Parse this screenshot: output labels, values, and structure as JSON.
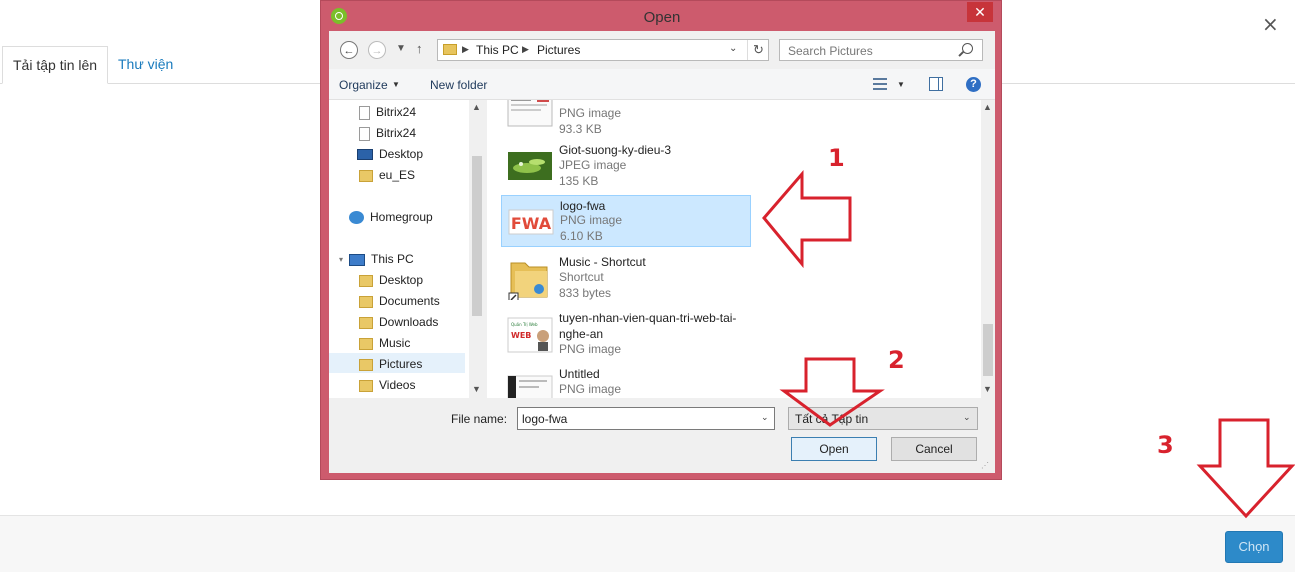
{
  "page": {
    "close_glyph": "×",
    "tabs": [
      "Tải tập tin lên",
      "Thư viện"
    ],
    "choose_button": "Chọn"
  },
  "dialog": {
    "title": "Open",
    "close_glyph": "✕",
    "address": {
      "segments": [
        "This PC",
        "Pictures"
      ]
    },
    "search_placeholder": "Search Pictures",
    "toolbar": {
      "organize": "Organize",
      "new_folder": "New folder",
      "help": "?"
    },
    "nav": [
      {
        "label": "Bitrix24",
        "icon": "document-icon"
      },
      {
        "label": "Bitrix24",
        "icon": "document-icon"
      },
      {
        "label": "Desktop",
        "icon": "desktop-icon"
      },
      {
        "label": "eu_ES",
        "icon": "folder-icon"
      },
      {
        "label": "Homegroup",
        "icon": "homegroup-icon"
      },
      {
        "label": "This PC",
        "icon": "computer-icon"
      },
      {
        "label": "Desktop",
        "icon": "folder-icon"
      },
      {
        "label": "Documents",
        "icon": "folder-icon"
      },
      {
        "label": "Downloads",
        "icon": "folder-icon"
      },
      {
        "label": "Music",
        "icon": "folder-icon"
      },
      {
        "label": "Pictures",
        "icon": "folder-icon",
        "selected": true
      },
      {
        "label": "Videos",
        "icon": "folder-icon"
      }
    ],
    "files": [
      {
        "name": "",
        "type": "PNG image",
        "size": "93.3 KB"
      },
      {
        "name": "Giot-suong-ky-dieu-3",
        "type": "JPEG image",
        "size": "135 KB"
      },
      {
        "name": "logo-fwa",
        "type": "PNG image",
        "size": "6.10 KB",
        "selected": true,
        "thumb_text": "FWA"
      },
      {
        "name": "Music - Shortcut",
        "type": "Shortcut",
        "size": "833 bytes"
      },
      {
        "name": "tuyen-nhan-vien-quan-tri-web-tai-nghe-an",
        "type": "PNG image",
        "size": "",
        "thumb_text": "WEB"
      },
      {
        "name": "Untitled",
        "type": "PNG image",
        "size": ""
      }
    ],
    "file_name_label": "File name:",
    "file_name_value": "logo-fwa",
    "file_type": "Tất cả Tập tin",
    "open_button": "Open",
    "cancel_button": "Cancel"
  },
  "annotations": [
    "1",
    "2",
    "3"
  ],
  "colors": {
    "dialog_frame": "#cd5b6d",
    "close_red": "#c7343a",
    "annotation_red": "#d8222d",
    "choose_button": "#2d8ac9"
  }
}
